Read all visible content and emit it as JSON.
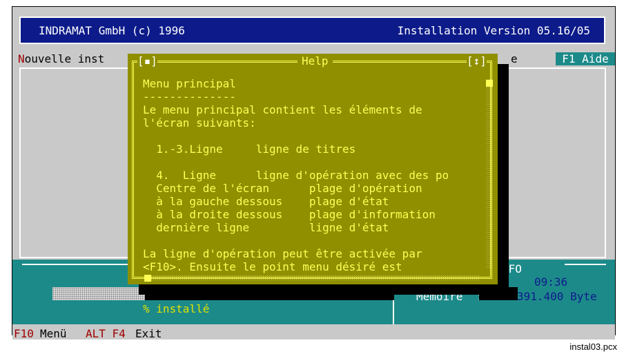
{
  "title_bar": {
    "left": "INDRAMAT GmbH (c) 1996",
    "right": "Installation Version 05.16/05"
  },
  "operation_line": {
    "new_install_hotkey": "N",
    "new_install_rest": "ouvelle inst",
    "partial_right": "e",
    "help_key": "F1 Aide"
  },
  "help_window": {
    "title": "Help",
    "close_glyph": "[▪]",
    "resize_glyph": "[↕]",
    "lines": [
      "Menu principal",
      "--------------",
      "Le menu principal contient les éléments de",
      "l'écran suivants:",
      "",
      "  1.-3.Ligne     ligne de titres",
      "",
      "  4.  Ligne      ligne d'opération avec des po",
      "  Centre de l'écran      plage d'opération",
      "  à la gauche dessous    plage d'état",
      "  à la droite dessous    plage d'information",
      "  dernière ligne         ligne d'état",
      "",
      "La ligne d'opération peut être activée par",
      "<F10>. Ensuite le point menu désiré est"
    ]
  },
  "status_area": {
    "progress_label": "% installé",
    "progress_fraction": 0.27,
    "info_title": "NFO",
    "time": "09:36",
    "memory_label": "Mémoire  :",
    "memory_value": "391.400 Byte"
  },
  "status_bar": {
    "f10_key": "F10",
    "f10_label": "Menü",
    "altf4_key": "ALT F4",
    "altf4_label": "Exit"
  },
  "caption": "instal03.pcx",
  "colors": {
    "title_bg": "#0d1b8a",
    "help_bg": "#8f8f00",
    "help_text": "#ffff55",
    "status_bg": "#1d8a8a",
    "hotkey": "#a00000"
  }
}
